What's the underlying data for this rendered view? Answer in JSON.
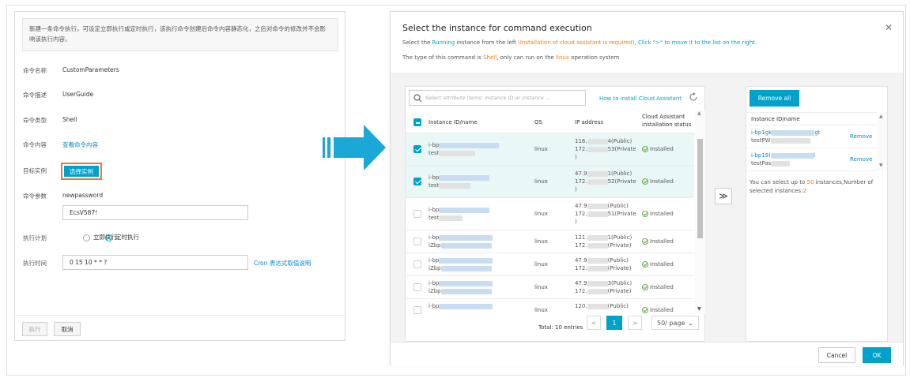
{
  "left_panel": {
    "notice": "新建一条命令执行，可设定立即执行或定时执行，该执行命令创建后命令内容静态化，之后对命令的修改并不会影响该执行内容。",
    "fields": {
      "name_label": "命令名称",
      "name_value": "CustomParameters",
      "desc_label": "命令描述",
      "desc_value": "UserGuide",
      "type_label": "命令类型",
      "type_value": "Shell",
      "content_label": "命令内容",
      "content_link": "查看命令内容",
      "target_label": "目标实例",
      "target_button": "选择实例",
      "params_label": "命令参数",
      "param_name": "newpassword",
      "param_value": "EcsV587!",
      "plan_label": "执行计划",
      "plan_now": "立即执行",
      "plan_timed": "定时执行",
      "time_label": "执行时间",
      "time_value": "0 15 10 * * ?",
      "cron_link": "Cron 表达式取值说明"
    },
    "buttons": {
      "execute": "执行",
      "cancel": "取消"
    }
  },
  "dialog": {
    "title": "Select the instance for command execution",
    "desc1": {
      "a": "Select the ",
      "b": "Running",
      "c": " instance from the left ",
      "d": "(Installation of cloud assistant is required),",
      "e": " Click \">\" to move it to the list on the right."
    },
    "desc2": {
      "a": "The type of this command is ",
      "b": "Shell",
      "c": ", only can run on the ",
      "d": "linux",
      "e": " operation system"
    },
    "search_placeholder": "Select attribute items: instance ID or instance ...",
    "install_link": "How to install Cloud Assistant",
    "columns": {
      "id": "Instance ID/name",
      "os": "OS",
      "ip": "IP address",
      "status1": "Cloud Assistant",
      "status2": "installation status"
    },
    "rows": [
      {
        "id_prefix": "i-bp",
        "name_prefix": "test",
        "os": "linux",
        "ip1_pre": "116.",
        "ip1_suf": "4(Public)",
        "ip2_pre": "172.",
        "ip2_suf": "53(Private",
        "ip3": ")",
        "status": "Installed",
        "checked": true
      },
      {
        "id_prefix": "i-bp",
        "name_prefix": "test",
        "os": "linux",
        "ip1_pre": "47.9",
        "ip1_suf": "1(Public)",
        "ip2_pre": "172.",
        "ip2_suf": "52(Private",
        "ip3": ")",
        "status": "Installed",
        "checked": true
      },
      {
        "id_prefix": "i-bp",
        "name_prefix": "test",
        "os": "linux",
        "ip1_pre": "47.9",
        "ip1_suf": "(Public)",
        "ip2_pre": "172.",
        "ip2_suf": "51(Private",
        "ip3": ")",
        "status": "Installed",
        "checked": false
      },
      {
        "id_prefix": "i-bp",
        "name_prefix": "iZbp",
        "os": "linux",
        "ip1_pre": "121.",
        "ip1_suf": "1(Public)",
        "ip2_pre": "172.",
        "ip2_suf": "(Private)",
        "ip3": "",
        "status": "Installed",
        "checked": false
      },
      {
        "id_prefix": "i-bp",
        "name_prefix": "iZbp",
        "os": "linux",
        "ip1_pre": "47.9",
        "ip1_suf": "(Public)",
        "ip2_pre": "172.",
        "ip2_suf": "(Private)",
        "ip3": "",
        "status": "Installed",
        "checked": false
      },
      {
        "id_prefix": "i-bp",
        "name_prefix": "iZbp",
        "os": "linux",
        "ip1_pre": "47.9",
        "ip1_suf": "3(Public)",
        "ip2_pre": "172.",
        "ip2_suf": "(Private)",
        "ip3": "",
        "status": "Installed",
        "checked": false
      },
      {
        "id_prefix": "i-bp",
        "name_prefix": "",
        "os": "linux",
        "ip1_pre": "120.",
        "ip1_suf": "(Public)",
        "ip2_pre": "",
        "ip2_suf": "",
        "ip3": "",
        "status": "Installed",
        "checked": false
      }
    ],
    "pagination": {
      "total": "Total: 10 entries",
      "prev": "<",
      "page": "1",
      "next": ">",
      "page_size": "50/ page"
    },
    "move_label": "≫",
    "selected": {
      "remove_all": "Remove all",
      "header": "Instance ID/name",
      "items": [
        {
          "id_prefix": "i-bp1gk",
          "id_suffix": "gt",
          "name_prefix": "testPW",
          "remove": "Remove"
        },
        {
          "id_prefix": "i-bp19(",
          "id_suffix": "l",
          "name_prefix": "testPas",
          "remove": "Remove"
        }
      ],
      "limit_text_a": "You can select up to ",
      "limit_num": "50",
      "limit_text_b": " instances,Number of selected instances:",
      "selected_count": "2"
    },
    "footer": {
      "cancel": "Cancel",
      "ok": "OK"
    }
  },
  "colors": {
    "accent": "#00a2ca",
    "highlight": "#f07c14",
    "arrow": "#1aa8d6"
  }
}
